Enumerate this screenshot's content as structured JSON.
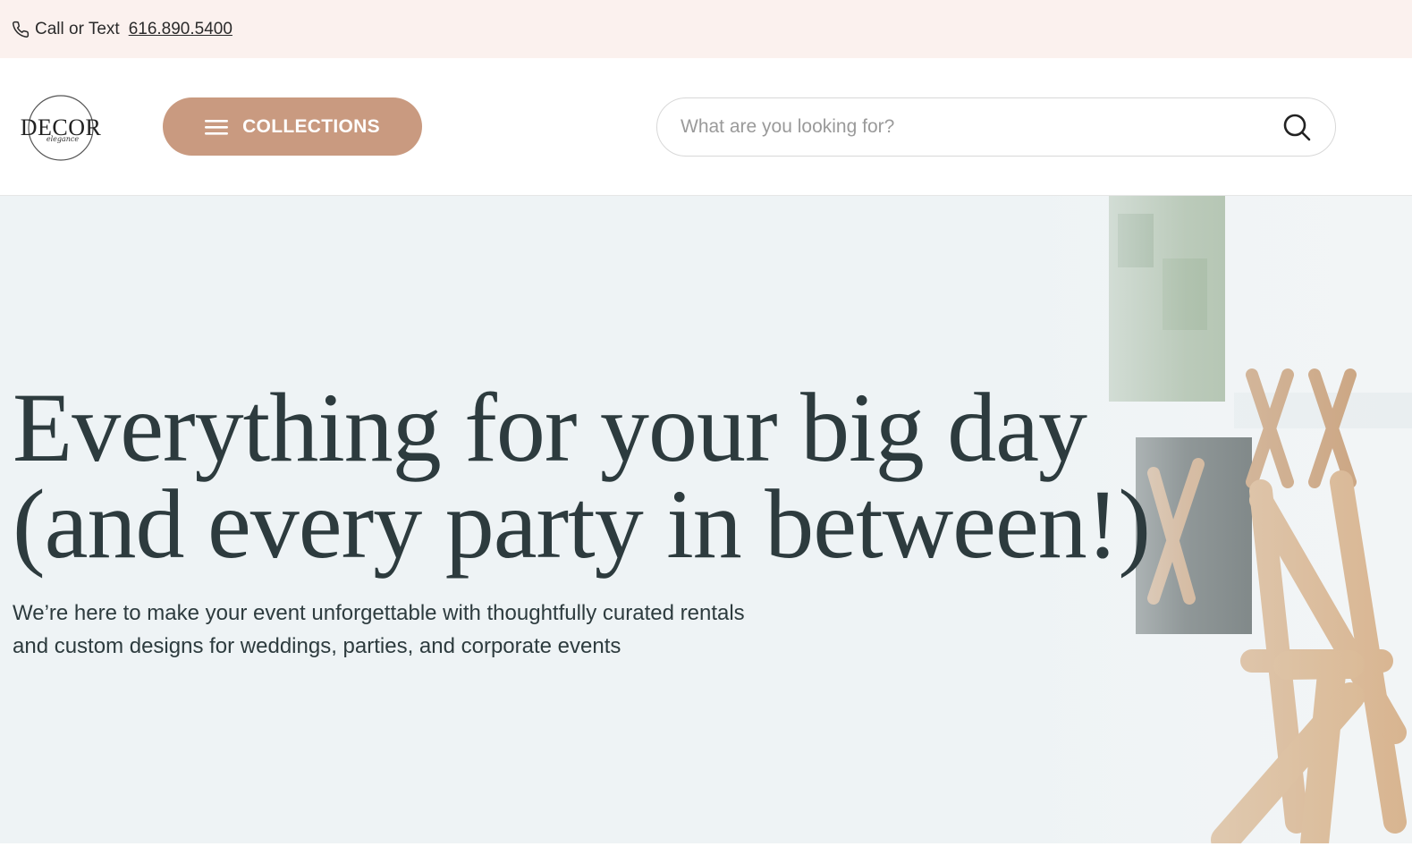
{
  "topbar": {
    "label": "Call or Text",
    "phone": "616.890.5400",
    "icon": "phone-icon"
  },
  "header": {
    "logo_text": "DECOR",
    "logo_script": "elegance",
    "collections_label": "COLLECTIONS",
    "search_placeholder": "What are you looking for?"
  },
  "hero": {
    "headline_line1": "Everything for your big day",
    "headline_line2": "(and every party in between!)",
    "subtext_line1": "We’re here to make your event unforgettable with thoughtfully curated rentals",
    "subtext_line2": "and custom designs for weddings, parties, and corporate events"
  },
  "colors": {
    "topbar_bg": "#fbf1ee",
    "accent": "#c99a80",
    "headline": "#2d3b3e",
    "hero_bg": "#eef3f5"
  }
}
